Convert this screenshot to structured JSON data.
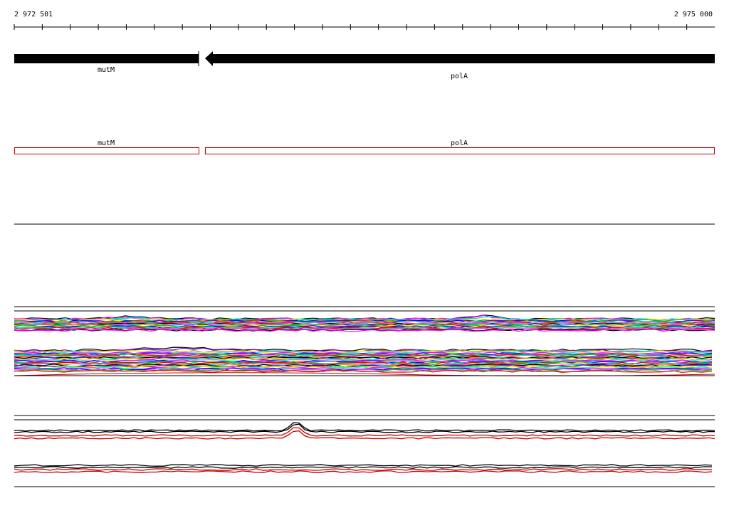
{
  "ruler": {
    "start_label": "2 972 501",
    "end_label": "2 975 000"
  },
  "genes": [
    {
      "name": "mutM",
      "strand": "-"
    },
    {
      "name": "polA",
      "strand": "-"
    }
  ],
  "features": [
    {
      "name": "mutM"
    },
    {
      "name": "polA"
    }
  ],
  "colors": {
    "gene_arrow": "#000000",
    "feature_outline": "#cc0000",
    "profile_palette": [
      "#000000",
      "#ff00ff",
      "#00ccff",
      "#ffee00",
      "#00cc00",
      "#8800cc",
      "#0000ff",
      "#ff8800",
      "#00ffcc",
      "#ff0000",
      "#888888",
      "#cc66ff"
    ]
  }
}
